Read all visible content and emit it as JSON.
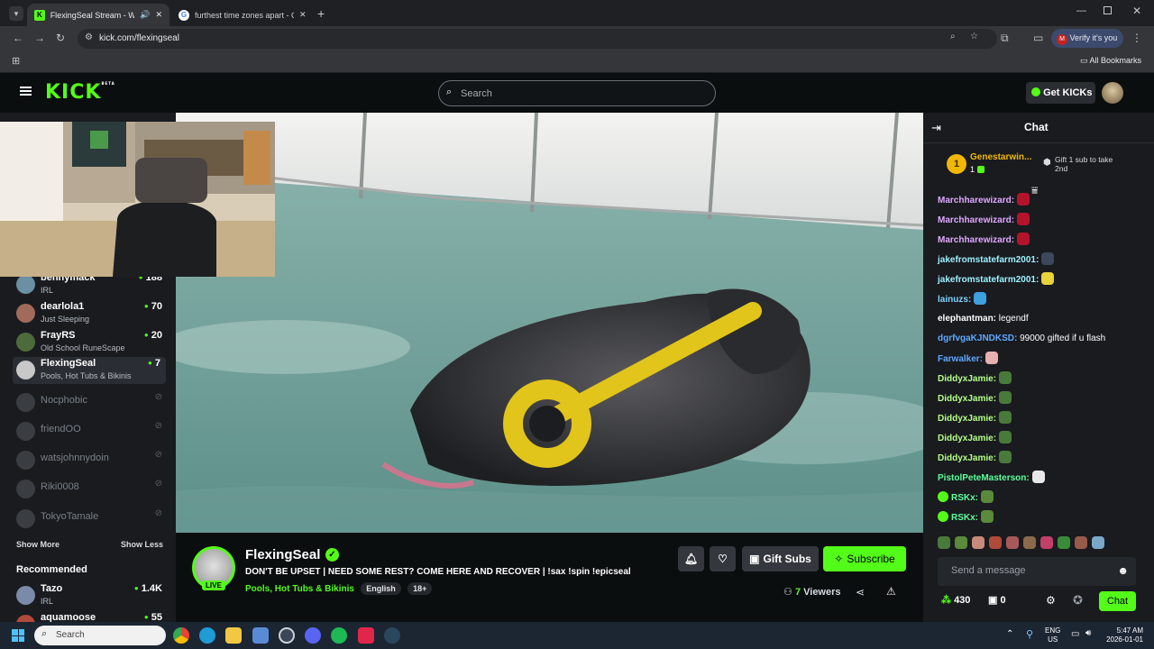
{
  "browser": {
    "tabs": [
      {
        "title": "FlexingSeal Stream - Watch",
        "favicon": "kick-favicon"
      },
      {
        "title": "furthest time zones apart - Goo",
        "favicon": "google-favicon"
      }
    ],
    "url": "kick.com/flexingseal",
    "profile_label": "Verify it's you",
    "profile_initial": "M",
    "bookmarks_label": "All Bookmarks"
  },
  "header": {
    "logo": "KICK",
    "logo_sup": "BETA",
    "search_placeholder": "Search",
    "get_kicks_label": "Get KICKs"
  },
  "sidebar": {
    "channels": [
      {
        "name": "bennymack",
        "category": "IRL",
        "viewers": "188"
      },
      {
        "name": "dearlola1",
        "category": "Just Sleeping",
        "viewers": "70"
      },
      {
        "name": "FrayRS",
        "category": "Old School RuneScape",
        "viewers": "20"
      },
      {
        "name": "FlexingSeal",
        "category": "Pools, Hot Tubs & Bikinis",
        "viewers": "7"
      }
    ],
    "offline": [
      "Nocphobic",
      "friendOO",
      "watsjohnnydoin",
      "Riki0008",
      "TokyoTamale"
    ],
    "show_more": "Show More",
    "show_less": "Show Less",
    "recommended_title": "Recommended",
    "recommended": [
      {
        "name": "Tazo",
        "category": "IRL",
        "viewers": "1.4K"
      },
      {
        "name": "aquamoose",
        "category": "",
        "viewers": "55"
      }
    ]
  },
  "stream": {
    "channel": "FlexingSeal",
    "title": "DON'T BE UPSET | NEED SOME REST? COME HERE AND RECOVER | !sax !spin !epicseal",
    "category": "Pools, Hot Tubs & Bikinis",
    "tags": [
      "English",
      "18+"
    ],
    "live_badge": "LIVE",
    "viewers_count": "7",
    "viewers_label": "Viewers",
    "gift_subs_label": "Gift Subs",
    "subscribe_label": "Subscribe"
  },
  "chat": {
    "title": "Chat",
    "leaderboard_rank": "1",
    "leaderboard_name": "Genestarwin...",
    "leaderboard_count": "1",
    "gift_text": "Gift 1 sub to take 2nd",
    "messages": [
      {
        "user": "Marchharewizard:",
        "text": "",
        "color": "#e0a8ff",
        "emote": "#b5132b"
      },
      {
        "user": "Marchharewizard:",
        "text": "",
        "color": "#e0a8ff",
        "emote": "#b5132b"
      },
      {
        "user": "Marchharewizard:",
        "text": "",
        "color": "#e0a8ff",
        "emote": "#b5132b"
      },
      {
        "user": "jakefromstatefarm2001:",
        "text": "",
        "color": "#9ef0ff",
        "emote": "#3a4a5c"
      },
      {
        "user": "jakefromstatefarm2001:",
        "text": "",
        "color": "#9ef0ff",
        "emote": "#e8d33a"
      },
      {
        "user": "lainuzs:",
        "text": "",
        "color": "#7fd4ff",
        "emote": "#3fa0e0"
      },
      {
        "user": "elephantman:",
        "text": "legendf",
        "color": "#ffffff",
        "emote": ""
      },
      {
        "user": "dgrfvgaKJNDKSD:",
        "text": "99000 gifted if u flash",
        "color": "#5fa8ff",
        "emote": ""
      },
      {
        "user": "Farwalker:",
        "text": "",
        "color": "#5fa8ff",
        "emote": "#e7b0b0"
      },
      {
        "user": "DiddyxJamie:",
        "text": "",
        "color": "#b5ff8a",
        "emote": "#4a7a3a"
      },
      {
        "user": "DiddyxJamie:",
        "text": "",
        "color": "#b5ff8a",
        "emote": "#4a7a3a"
      },
      {
        "user": "DiddyxJamie:",
        "text": "",
        "color": "#b5ff8a",
        "emote": "#4a7a3a"
      },
      {
        "user": "DiddyxJamie:",
        "text": "",
        "color": "#b5ff8a",
        "emote": "#4a7a3a"
      },
      {
        "user": "DiddyxJamie:",
        "text": "",
        "color": "#b5ff8a",
        "emote": "#4a7a3a"
      },
      {
        "user": "PistolPeteMasterson:",
        "text": "",
        "color": "#5cff9a",
        "emote": "#e8e8e8"
      },
      {
        "user": "RSKx:",
        "text": "",
        "color": "#5cff9a",
        "emote": "#5a8a3a"
      },
      {
        "user": "RSKx:",
        "text": "",
        "color": "#5cff9a",
        "emote": "#5a8a3a"
      }
    ],
    "input_placeholder": "Send a message",
    "points": "430",
    "gifts": "0",
    "send_label": "Chat"
  },
  "taskbar": {
    "search_placeholder": "Search",
    "lang": "ENG",
    "region": "US",
    "time": "5:47 AM",
    "date": "2026-01-01"
  },
  "colors": {
    "accent": "#53fc18",
    "background": "#0b0e0f",
    "panel": "#191b1f"
  }
}
